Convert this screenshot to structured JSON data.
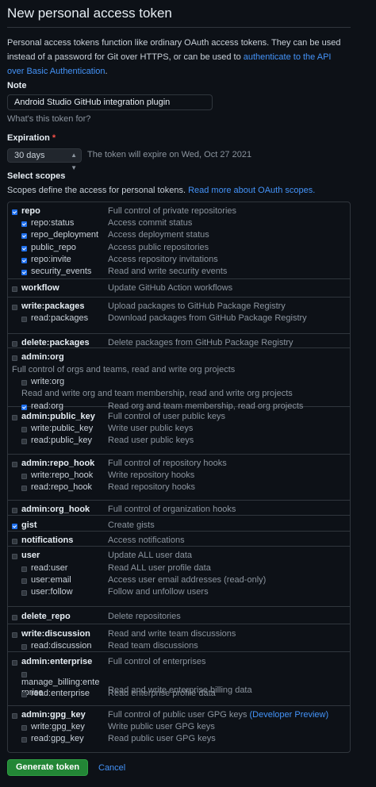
{
  "header": {
    "title": "New personal access token"
  },
  "intro": {
    "text": "Personal access tokens function like ordinary OAuth access tokens. They can be used instead of a password for Git over HTTPS, or can be used to ",
    "link": "authenticate to the API over Basic Authentication",
    "suffix": "."
  },
  "note": {
    "label": "Note",
    "value": "Android Studio GitHub integration plugin",
    "hint": "What's this token for?"
  },
  "expiration": {
    "label": "Expiration",
    "required_mark": "*",
    "selected": "30 days",
    "text": "The token will expire on Wed, Oct 27 2021"
  },
  "scopes": {
    "label": "Select scopes",
    "description": "Scopes define the access for personal tokens. ",
    "link": "Read more about OAuth scopes.",
    "groups": [
      {
        "rows": [
          {
            "name": "repo",
            "desc": "Full control of private repositories",
            "checked": true,
            "parent": true
          },
          {
            "name": "repo:status",
            "desc": "Access commit status",
            "checked": true
          },
          {
            "name": "repo_deployment",
            "desc": "Access deployment status",
            "checked": true
          },
          {
            "name": "public_repo",
            "desc": "Access public repositories",
            "checked": true
          },
          {
            "name": "repo:invite",
            "desc": "Access repository invitations",
            "checked": true
          },
          {
            "name": "security_events",
            "desc": "Read and write security events",
            "checked": true
          }
        ]
      },
      {
        "rows": [
          {
            "name": "workflow",
            "desc": "Update GitHub Action workflows",
            "checked": false,
            "parent": true
          }
        ]
      },
      {
        "rows": [
          {
            "name": "write:packages",
            "desc": "Upload packages to GitHub Package Registry",
            "checked": false,
            "parent": true
          },
          {
            "name": "read:packages",
            "desc": "Download packages from GitHub Package Registry",
            "checked": false
          }
        ]
      },
      {
        "rows": [
          {
            "name": "delete:packages",
            "desc": "Delete packages from GitHub Package Registry",
            "checked": false,
            "parent": true
          }
        ]
      },
      {
        "rows": [
          {
            "name": "admin:org",
            "desc": "",
            "checked": false,
            "parent": true
          },
          {
            "plain": "Full control of orgs and teams, read and write org projects"
          },
          {
            "name": "write:org",
            "desc": "",
            "checked": false
          },
          {
            "plain2": "Read and write org and team membership, read and write org projects"
          },
          {
            "name": "read:org",
            "desc": "Read org and team membership, read org projects",
            "checked": true
          }
        ]
      },
      {
        "rows": [
          {
            "name": "admin:public_key",
            "desc": "Full control of user public keys",
            "checked": false,
            "parent": true
          },
          {
            "name": "write:public_key",
            "desc": "Write user public keys",
            "checked": false
          },
          {
            "name": "read:public_key",
            "desc": "Read user public keys",
            "checked": false
          }
        ]
      },
      {
        "rows": [
          {
            "name": "admin:repo_hook",
            "desc": "Full control of repository hooks",
            "checked": false,
            "parent": true
          },
          {
            "name": "write:repo_hook",
            "desc": "Write repository hooks",
            "checked": false
          },
          {
            "name": "read:repo_hook",
            "desc": "Read repository hooks",
            "checked": false
          }
        ]
      },
      {
        "rows": [
          {
            "name": "admin:org_hook",
            "desc": "Full control of organization hooks",
            "checked": false,
            "parent": true
          }
        ]
      },
      {
        "rows": [
          {
            "name": "gist",
            "desc": "Create gists",
            "checked": true,
            "parent": true
          }
        ]
      },
      {
        "rows": [
          {
            "name": "notifications",
            "desc": "Access notifications",
            "checked": false,
            "parent": true
          }
        ]
      },
      {
        "rows": [
          {
            "name": "user",
            "desc": "Update ALL user data",
            "checked": false,
            "parent": true
          },
          {
            "name": "read:user",
            "desc": "Read ALL user profile data",
            "checked": false
          },
          {
            "name": "user:email",
            "desc": "Access user email addresses (read-only)",
            "checked": false
          },
          {
            "name": "user:follow",
            "desc": "Follow and unfollow users",
            "checked": false
          }
        ]
      },
      {
        "rows": [
          {
            "name": "delete_repo",
            "desc": "Delete repositories",
            "checked": false,
            "parent": true
          }
        ]
      },
      {
        "rows": [
          {
            "name": "write:discussion",
            "desc": "Read and write team discussions",
            "checked": false,
            "parent": true
          },
          {
            "name": "read:discussion",
            "desc": "Read team discussions",
            "checked": false
          }
        ]
      },
      {
        "rows": [
          {
            "name": "admin:enterprise",
            "desc": "Full control of enterprises",
            "checked": false,
            "parent": true
          },
          {
            "wrap1": "manage_billing:ente",
            "wrap2": "rprise",
            "desc": "Read and write enterprise billing data",
            "checked": false
          },
          {
            "name": "read:enterprise",
            "desc": "Read enterprise profile data",
            "checked": false
          }
        ]
      },
      {
        "rows": [
          {
            "name": "admin:gpg_key",
            "desc": "Full control of public user GPG keys ",
            "desc_link": "(Developer Preview)",
            "checked": false,
            "parent": true
          },
          {
            "name": "write:gpg_key",
            "desc": "Write public user GPG keys",
            "checked": false
          },
          {
            "name": "read:gpg_key",
            "desc": "Read public user GPG keys",
            "checked": false
          }
        ]
      }
    ]
  },
  "actions": {
    "generate": "Generate token",
    "cancel": "Cancel"
  },
  "colors": {
    "background": "#0d1117",
    "link": "#4493f8",
    "primary_button": "#238636",
    "checkbox_on": "#1f6feb"
  }
}
